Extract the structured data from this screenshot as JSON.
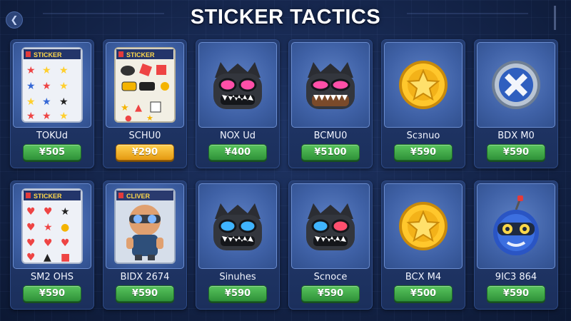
{
  "header": {
    "title": "STICKER TACTICS",
    "back_icon": "chevron-left-icon"
  },
  "items": [
    {
      "name": "TOKUd",
      "price": "¥505",
      "art": "sticker-sheet-stars-icon",
      "sheet_label": "STICKER",
      "style": "green"
    },
    {
      "name": "SCHU0",
      "price": "¥290",
      "art": "sticker-sheet-faces-icon",
      "sheet_label": "STICKER",
      "style": "gold"
    },
    {
      "name": "NOX Ud",
      "price": "¥400",
      "art": "monster-pink-eyes-icon",
      "style": "green"
    },
    {
      "name": "BCMU0",
      "price": "¥5100",
      "art": "monster-pink-eyes-icon",
      "style": "green"
    },
    {
      "name": "Scɜnuo",
      "price": "¥590",
      "art": "gold-star-coin-icon",
      "style": "green"
    },
    {
      "name": "BDX M0",
      "price": "¥590",
      "art": "cross-badge-icon",
      "style": "green"
    },
    {
      "name": "SM2 OHS",
      "price": "¥590",
      "art": "sticker-sheet-hearts-icon",
      "sheet_label": "STICKER",
      "style": "green"
    },
    {
      "name": "BIDX 2674",
      "price": "¥590",
      "art": "goggle-character-pack-icon",
      "sheet_label": "CLIVER",
      "style": "green"
    },
    {
      "name": "Sinuhes",
      "price": "¥590",
      "art": "monster-blue-eyes-icon",
      "style": "green"
    },
    {
      "name": "Scnoce",
      "price": "¥590",
      "art": "monster-blue-eyes-icon",
      "style": "green"
    },
    {
      "name": "BCX M4",
      "price": "¥500",
      "art": "gold-star-coin-icon",
      "style": "green"
    },
    {
      "name": "9IC3 864",
      "price": "¥590",
      "art": "robot-bomb-icon",
      "style": "green"
    }
  ]
}
